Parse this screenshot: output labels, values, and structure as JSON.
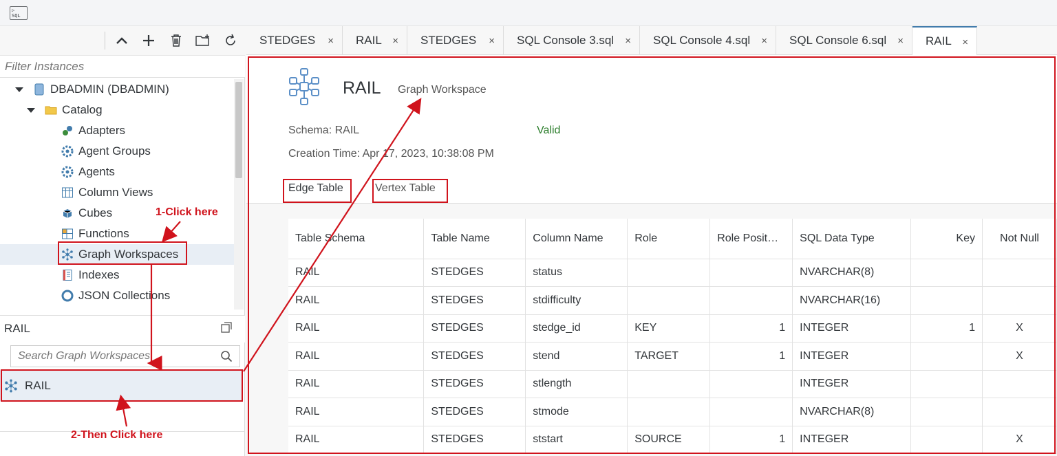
{
  "left_panel": {
    "filter_placeholder": "Filter Instances",
    "tree": [
      {
        "label": "DBADMIN (DBADMIN)",
        "icon": "database-icon",
        "level": 0
      },
      {
        "label": "Catalog",
        "icon": "folder-icon",
        "level": 1
      },
      {
        "label": "Adapters",
        "icon": "adapter-icon",
        "level": 2
      },
      {
        "label": "Agent Groups",
        "icon": "agent-group-icon",
        "level": 2
      },
      {
        "label": "Agents",
        "icon": "agent-icon",
        "level": 2
      },
      {
        "label": "Column Views",
        "icon": "column-view-icon",
        "level": 2
      },
      {
        "label": "Cubes",
        "icon": "cube-icon",
        "level": 2
      },
      {
        "label": "Functions",
        "icon": "function-icon",
        "level": 2
      },
      {
        "label": "Graph Workspaces",
        "icon": "graph-workspace-icon",
        "level": 2,
        "selected": true
      },
      {
        "label": "Indexes",
        "icon": "index-icon",
        "level": 2
      },
      {
        "label": "JSON Collections",
        "icon": "json-collection-icon",
        "level": 2
      }
    ],
    "workspace_list": {
      "title": "RAIL",
      "search_placeholder": "Search Graph Workspaces",
      "items": [
        "RAIL"
      ]
    }
  },
  "tabs": [
    {
      "label": "STEDGES"
    },
    {
      "label": "RAIL"
    },
    {
      "label": "STEDGES"
    },
    {
      "label": "SQL Console 3.sql"
    },
    {
      "label": "SQL Console 4.sql"
    },
    {
      "label": "SQL Console 6.sql"
    },
    {
      "label": "RAIL",
      "active": true
    }
  ],
  "tab_close": "×",
  "workspace": {
    "name": "RAIL",
    "type": "Graph Workspace",
    "schema": "Schema: RAIL",
    "status": "Valid",
    "creation_time": "Creation Time: Apr 17, 2023, 10:38:08 PM",
    "subtabs": [
      "Edge Table",
      "Vertex Table"
    ]
  },
  "table": {
    "headers": [
      "Table Schema",
      "Table Name",
      "Column Name",
      "Role",
      "Role Posit…",
      "SQL Data Type",
      "Key",
      "Not Null"
    ],
    "rows": [
      [
        "RAIL",
        "STEDGES",
        "status",
        "",
        "",
        "NVARCHAR(8)",
        "",
        ""
      ],
      [
        "RAIL",
        "STEDGES",
        "stdifficulty",
        "",
        "",
        "NVARCHAR(16)",
        "",
        ""
      ],
      [
        "RAIL",
        "STEDGES",
        "stedge_id",
        "KEY",
        "1",
        "INTEGER",
        "1",
        "X"
      ],
      [
        "RAIL",
        "STEDGES",
        "stend",
        "TARGET",
        "1",
        "INTEGER",
        "",
        "X"
      ],
      [
        "RAIL",
        "STEDGES",
        "stlength",
        "",
        "",
        "INTEGER",
        "",
        ""
      ],
      [
        "RAIL",
        "STEDGES",
        "stmode",
        "",
        "",
        "NVARCHAR(8)",
        "",
        ""
      ],
      [
        "RAIL",
        "STEDGES",
        "ststart",
        "SOURCE",
        "1",
        "INTEGER",
        "",
        "X"
      ]
    ]
  },
  "annotations": {
    "step1": "1-Click here",
    "step2": "2-Then Click here",
    "color": "#d0131c"
  }
}
